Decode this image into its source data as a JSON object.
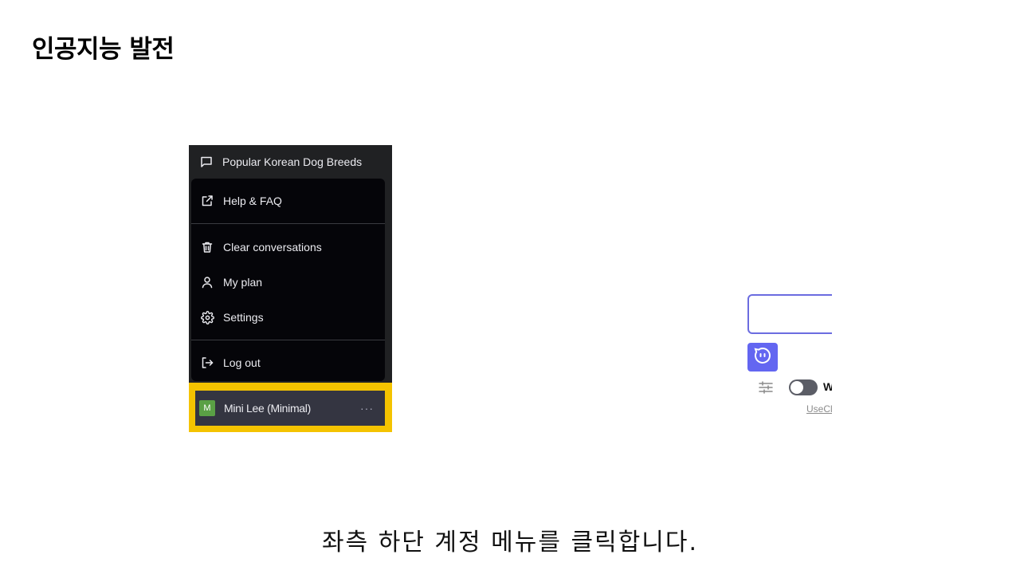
{
  "slide": {
    "title": "인공지능 발전",
    "caption": "좌측 하단 계정 메뉴를 클릭합니다."
  },
  "sidebar": {
    "conversation_item": {
      "label": "Popular Korean Dog Breeds",
      "icon": "chat-bubble-icon"
    },
    "menu": {
      "help": {
        "label": "Help & FAQ",
        "icon": "external-link-icon"
      },
      "clear": {
        "label": "Clear conversations",
        "icon": "trash-icon"
      },
      "plan": {
        "label": "My plan",
        "icon": "user-icon"
      },
      "settings": {
        "label": "Settings",
        "icon": "gear-icon"
      },
      "logout": {
        "label": "Log out",
        "icon": "logout-icon"
      }
    },
    "account": {
      "avatar_initial": "M",
      "name": "Mini Lee (Minimal)",
      "more": "···"
    }
  },
  "chat_panel": {
    "toggle_label": "W",
    "footer_link": "UseCl"
  },
  "colors": {
    "highlight": "#f4c300",
    "sidebar_bg": "#202123",
    "popup_bg": "#050509",
    "account_bg": "#343541",
    "avatar_bg": "#5aa045",
    "accent": "#6366f1"
  }
}
